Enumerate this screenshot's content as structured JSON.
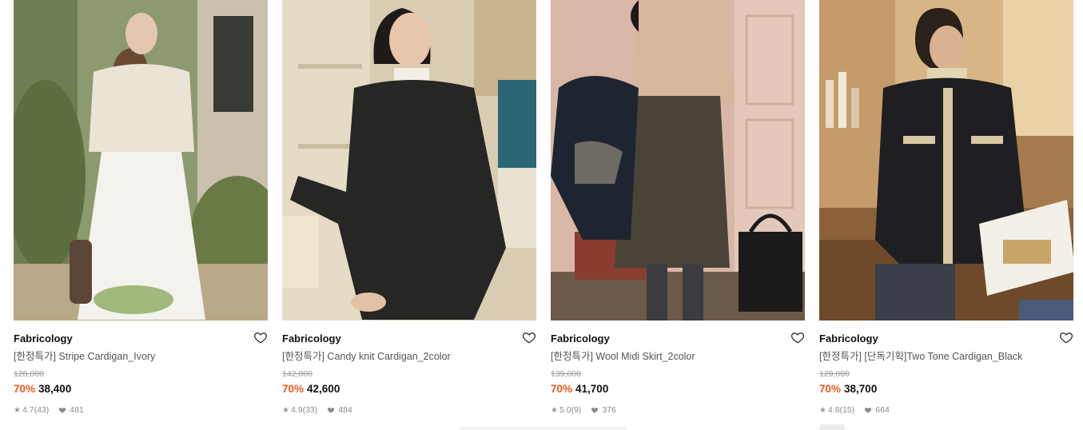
{
  "products": [
    {
      "brand": "Fabricology",
      "title": "[한정특가] Stripe Cardigan_Ivory",
      "original_price": "128,000",
      "discount": "70%",
      "price": "38,400",
      "rating": "4.7",
      "reviews": "(43)",
      "likes": "481",
      "image": "woman-ivory-knit-cardigan-white-skirt"
    },
    {
      "brand": "Fabricology",
      "title": "[한정특가] Candy knit Cardigan_2color",
      "original_price": "142,000",
      "discount": "70%",
      "price": "42,600",
      "rating": "4.9",
      "reviews": "(33)",
      "likes": "484",
      "image": "woman-black-knit-cardigan"
    },
    {
      "brand": "Fabricology",
      "title": "[한정특가] Wool Midi Skirt_2color",
      "original_price": "139,000",
      "discount": "70%",
      "price": "41,700",
      "rating": "5.0",
      "reviews": "(9)",
      "likes": "376",
      "image": "woman-wool-midi-skirt-beige-top"
    },
    {
      "brand": "Fabricology",
      "title": "[한정특가] [단독기획]Two Tone Cardigan_Black",
      "original_price": "129,000",
      "discount": "70%",
      "price": "38,700",
      "rating": "4.8",
      "reviews": "(15)",
      "likes": "664",
      "image": "woman-two-tone-black-cardigan-reading"
    }
  ],
  "colors": {
    "discount": "#e85a1c",
    "muted": "#8a8a8a"
  },
  "icons": {
    "wishlist": "heart-outline-icon",
    "rating": "star-icon",
    "likes": "heart-filled-icon"
  }
}
